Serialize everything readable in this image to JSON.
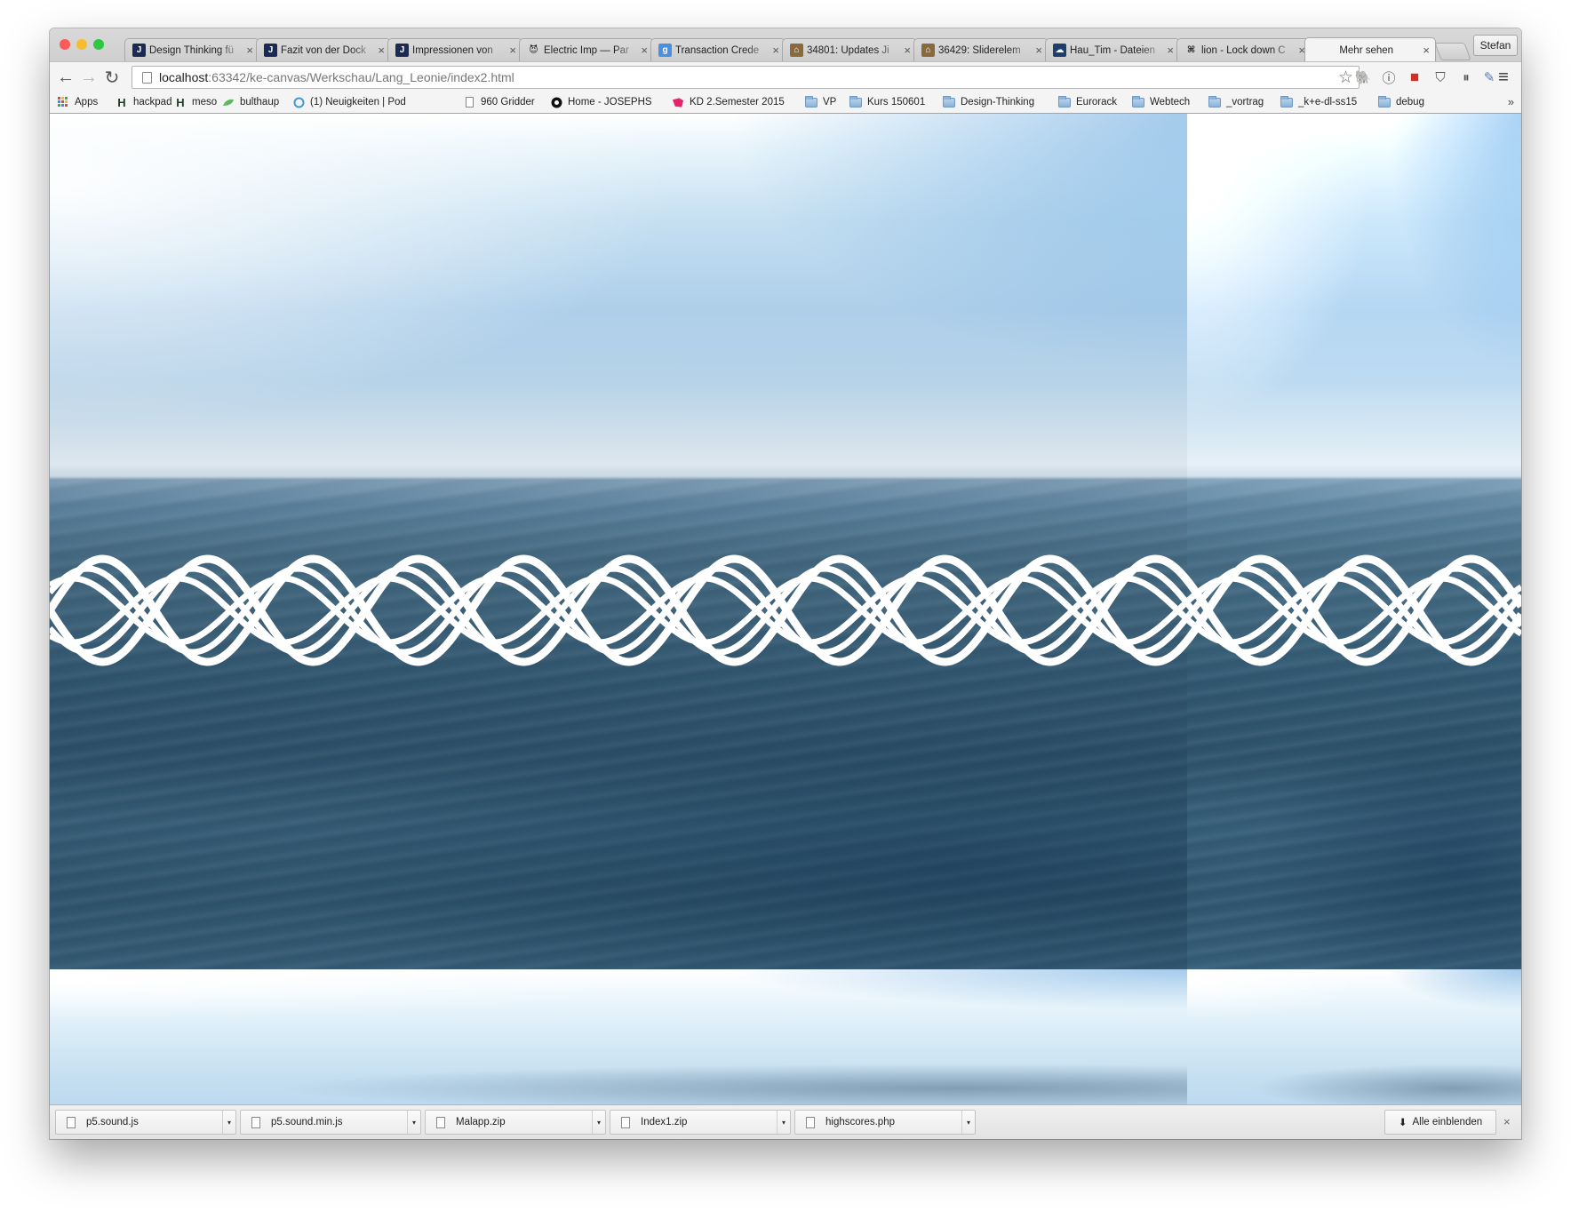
{
  "window": {
    "traffic_lights": {
      "close": "#fc5b57",
      "minimize": "#f8bd2e",
      "zoom": "#2cc840"
    },
    "profile_label": "Stefan"
  },
  "tabs": [
    {
      "title": "Design Thinking fü",
      "favicon": "jimdo-j",
      "color": "#1b2a55",
      "glyph": "J"
    },
    {
      "title": "Fazit von der Dock",
      "favicon": "jimdo-j",
      "color": "#1b2a55",
      "glyph": "J"
    },
    {
      "title": "Impressionen von",
      "favicon": "jimdo-j",
      "color": "#1b2a55",
      "glyph": "J"
    },
    {
      "title": "Electric Imp — Par",
      "favicon": "electric-imp-icon",
      "color": "#ffffff",
      "glyph": "😈"
    },
    {
      "title": "Transaction Crede",
      "favicon": "google-g",
      "color": "#4a90e2",
      "glyph": "g"
    },
    {
      "title": "34801: Updates Ji",
      "favicon": "house-icon",
      "color": "#8a6a3a",
      "glyph": "⌂"
    },
    {
      "title": "36429: Sliderelem",
      "favicon": "house-icon",
      "color": "#8a6a3a",
      "glyph": "⌂"
    },
    {
      "title": "Hau_Tim - Dateien",
      "favicon": "cloud-icon",
      "color": "#1d3f6e",
      "glyph": "☁"
    },
    {
      "title": "lion - Lock down C",
      "favicon": "command-icon",
      "color": "#ffffff",
      "glyph": "⌘"
    },
    {
      "title": "Mehr sehen",
      "favicon": "none",
      "color": "",
      "glyph": "",
      "active": true
    }
  ],
  "toolbar": {
    "url_host": "localhost",
    "url_rest": ":63342/ke-canvas/Werkschau/Lang_Leonie/index2.html",
    "back": "←",
    "forward": "→",
    "reload": "↻",
    "star": "☆"
  },
  "extensions": [
    {
      "name": "evernote-icon",
      "glyph": "🐘",
      "color": "#555"
    },
    {
      "name": "info-icon",
      "glyph": "ⓘ",
      "color": "#444"
    },
    {
      "name": "lastpass-icon",
      "glyph": "■",
      "color": "#d32d27"
    },
    {
      "name": "pocket-icon",
      "glyph": "⛉",
      "color": "#555"
    },
    {
      "name": "pause-icon",
      "glyph": "⏸",
      "color": "#555"
    },
    {
      "name": "eyedropper-icon",
      "glyph": "✎",
      "color": "#4a7fc1"
    },
    {
      "name": "menu-icon",
      "glyph": "≡",
      "color": "#333"
    }
  ],
  "bookmarks": [
    {
      "label": "Apps",
      "icon": "apps-grid-icon"
    },
    {
      "label": "hackpad",
      "icon": "h-icon"
    },
    {
      "label": "meso",
      "icon": "h-icon"
    },
    {
      "label": "bulthaup",
      "icon": "leaf-icon"
    },
    {
      "label": "(1) Neuigkeiten | Pod",
      "icon": "podio-icon"
    },
    {
      "label": "960 Gridder",
      "icon": "page-icon"
    },
    {
      "label": "Home - JOSEPHS",
      "icon": "josephs-icon"
    },
    {
      "label": "KD 2.Semester 2015",
      "icon": "kd-icon"
    },
    {
      "label": "VP",
      "icon": "folder-icon"
    },
    {
      "label": "Kurs 150601",
      "icon": "folder-icon"
    },
    {
      "label": "Design-Thinking",
      "icon": "folder-icon"
    },
    {
      "label": "Eurorack",
      "icon": "folder-icon"
    },
    {
      "label": "Webtech",
      "icon": "folder-icon"
    },
    {
      "label": "_vortrag",
      "icon": "folder-icon"
    },
    {
      "label": "_k+e-dl-ss15",
      "icon": "folder-icon"
    },
    {
      "label": "debug",
      "icon": "folder-icon"
    }
  ],
  "bookmarks_more": "»",
  "downloads": [
    {
      "name": "p5.sound.js"
    },
    {
      "name": "p5.sound.min.js"
    },
    {
      "name": "Malapp.zip"
    },
    {
      "name": "Index1.zip"
    },
    {
      "name": "highscores.php"
    }
  ],
  "downloads_show_all": "Alle einblenden",
  "downloads_close": "×",
  "canvas": {
    "content": "sea-horizon photo tiled, white sine-wave helix band",
    "wave_color": "#ffffff"
  }
}
